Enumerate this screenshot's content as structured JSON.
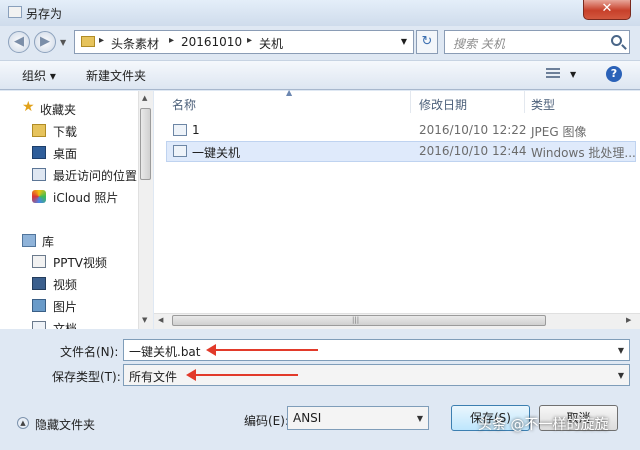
{
  "window": {
    "title": "另存为",
    "close_glyph": "✕"
  },
  "nav": {
    "back_glyph": "◀",
    "forward_glyph": "▶",
    "breadcrumbs": [
      "头条素材",
      "20161010",
      "关机"
    ],
    "refresh_glyph": "↻",
    "search_placeholder": "搜索 关机"
  },
  "toolbar": {
    "organize": "组织 ▾",
    "new_folder": "新建文件夹",
    "help": "?"
  },
  "sidebar": {
    "items": [
      {
        "label": "收藏夹",
        "icon": "star-icon"
      },
      {
        "label": "下载",
        "icon": "download-folder-icon"
      },
      {
        "label": "桌面",
        "icon": "desktop-icon"
      },
      {
        "label": "最近访问的位置",
        "icon": "recent-places-icon"
      },
      {
        "label": "iCloud 照片",
        "icon": "icloud-photos-icon"
      },
      {
        "label": "库",
        "icon": "library-icon"
      },
      {
        "label": "PPTV视频",
        "icon": "pptv-icon"
      },
      {
        "label": "视频",
        "icon": "video-library-icon"
      },
      {
        "label": "图片",
        "icon": "pictures-library-icon"
      },
      {
        "label": "文档",
        "icon": "documents-library-icon"
      }
    ]
  },
  "files": {
    "columns": {
      "name": "名称",
      "date": "修改日期",
      "type": "类型"
    },
    "rows": [
      {
        "name": "1",
        "date": "2016/10/10 12:22",
        "type": "JPEG 图像",
        "icon": "image-file-icon"
      },
      {
        "name": "一键关机",
        "date": "2016/10/10 12:44",
        "type": "Windows 批处理...",
        "icon": "batch-file-icon"
      }
    ]
  },
  "form": {
    "filename_label": "文件名(N):",
    "filename_value": "一键关机.bat",
    "filetype_label": "保存类型(T):",
    "filetype_value": "所有文件",
    "encoding_label": "编码(E):",
    "encoding_value": "ANSI",
    "hide_folders": "隐藏文件夹",
    "save": "保存(S)",
    "cancel": "取消"
  },
  "colors": {
    "accent": "#2b62b8",
    "annotation_arrow": "#e23a2a",
    "selection": "#dfeafb"
  },
  "watermark": "头条 @不一样的旋旋"
}
